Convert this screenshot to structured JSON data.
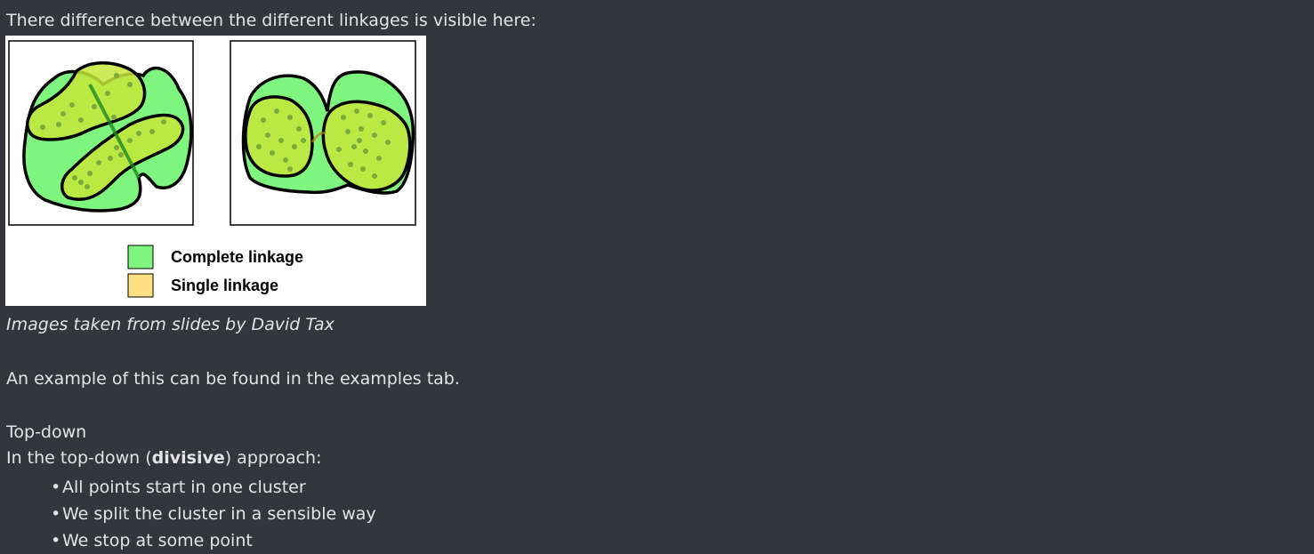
{
  "intro": "There difference between the different linkages is visible here:",
  "figure": {
    "legend": [
      {
        "label": "Complete linkage",
        "color": "#7ef57e"
      },
      {
        "label": "Single linkage",
        "color": "#ffe082"
      }
    ]
  },
  "caption": "Images taken from slides by David Tax",
  "example_text": "An example of this can be found in the examples tab.",
  "section": {
    "heading": "Top-down",
    "desc_before": "In the top-down (",
    "desc_bold": "divisive",
    "desc_after": ") approach:",
    "bullets": [
      "All points start in one cluster",
      "We split the cluster in a sensible way",
      "We stop at some point"
    ]
  }
}
